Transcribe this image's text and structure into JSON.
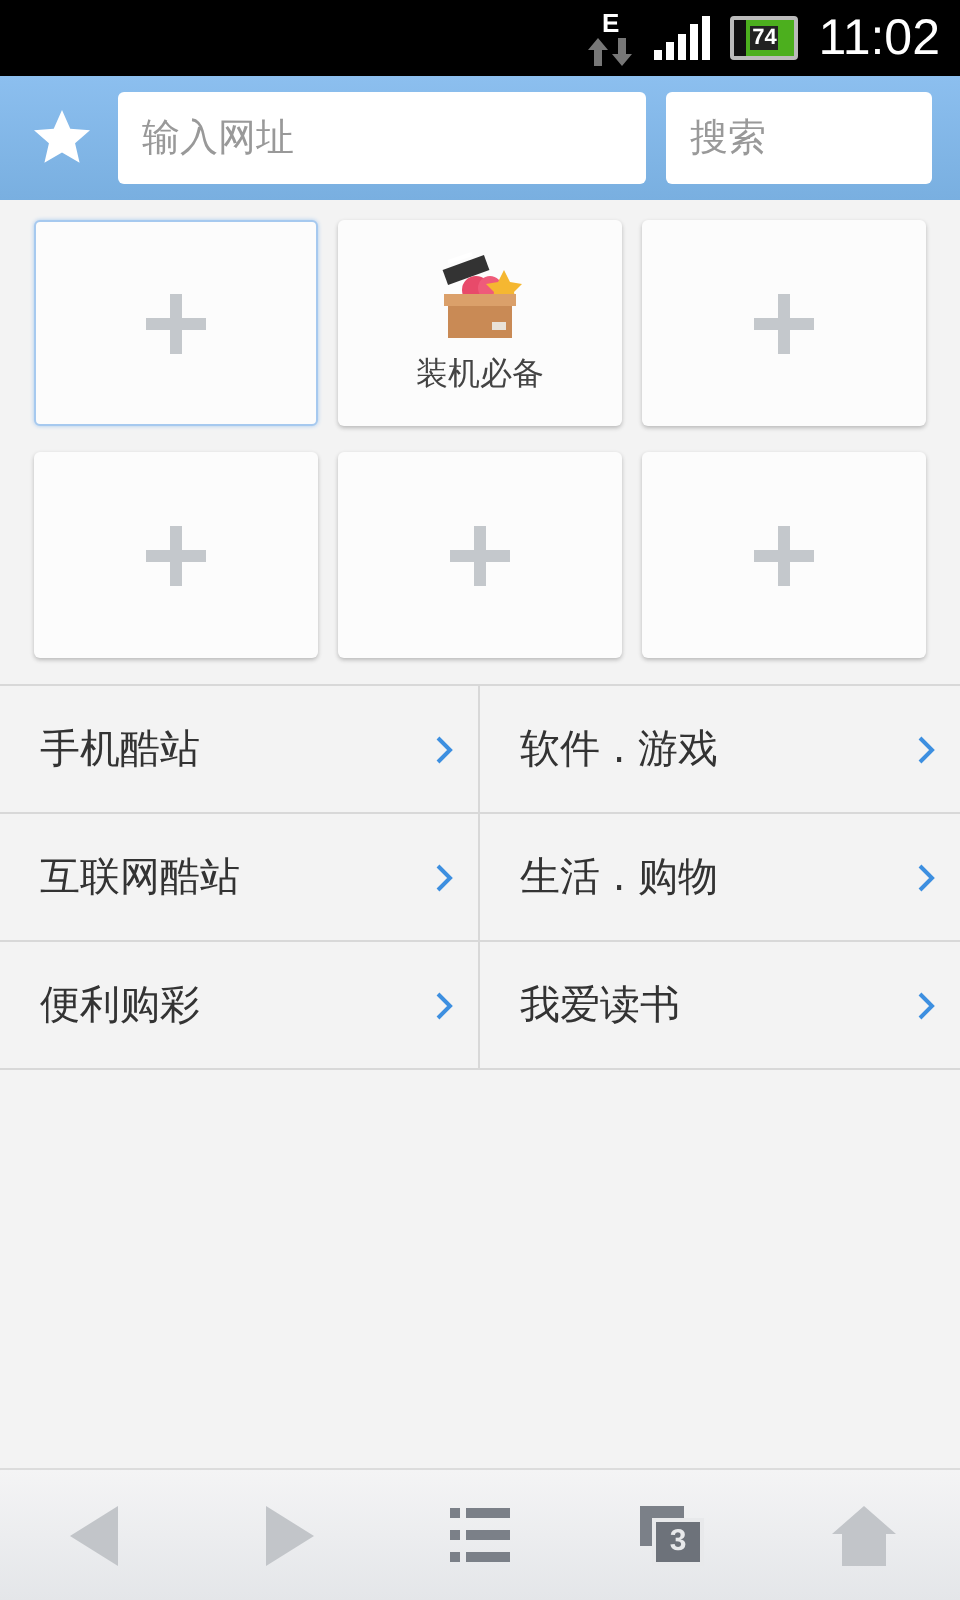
{
  "status_bar": {
    "network": "E",
    "battery": "74",
    "time": "11:02"
  },
  "header": {
    "url_placeholder": "输入网址",
    "search_placeholder": "搜索"
  },
  "tiles": [
    {
      "kind": "add",
      "selected": true
    },
    {
      "kind": "app",
      "label": "装机必备",
      "selected": false
    },
    {
      "kind": "add",
      "selected": false
    },
    {
      "kind": "add",
      "selected": false
    },
    {
      "kind": "add",
      "selected": false
    },
    {
      "kind": "add",
      "selected": false
    }
  ],
  "links": [
    {
      "label": "手机酷站"
    },
    {
      "label": "软件 . 游戏"
    },
    {
      "label": "互联网酷站"
    },
    {
      "label": "生活 . 购物"
    },
    {
      "label": "便利购彩"
    },
    {
      "label": "我爱读书"
    }
  ],
  "toolbar": [
    {
      "kind": "back",
      "disabled": true
    },
    {
      "kind": "forward",
      "disabled": true
    },
    {
      "kind": "menu",
      "disabled": false
    },
    {
      "kind": "tabs",
      "count": "3",
      "disabled": false
    },
    {
      "kind": "home",
      "disabled": true
    }
  ]
}
